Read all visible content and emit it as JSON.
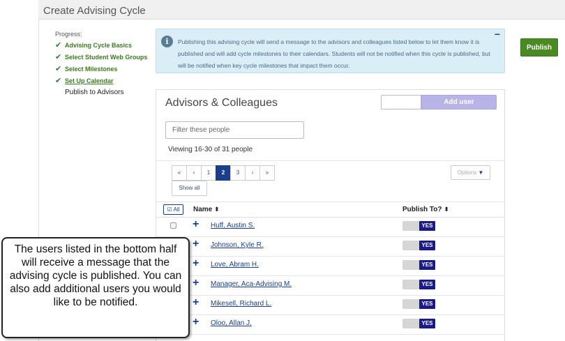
{
  "page": {
    "title": "Create Advising Cycle"
  },
  "progress": {
    "label": "Progress:",
    "steps": [
      {
        "label": "Advising Cycle Basics",
        "status": "complete"
      },
      {
        "label": "Select Student Web Groups",
        "status": "complete"
      },
      {
        "label": "Select Milestones",
        "status": "complete"
      },
      {
        "label": "Set Up Calendar",
        "status": "complete-link"
      },
      {
        "label": "Publish to Advisors",
        "status": "current"
      }
    ]
  },
  "info": {
    "text": "Publishing this advising cycle will send a message to the advisors and colleagues listed below to let them know it is published and will add cycle milestones to their calendars. Students will not be notified when this cycle is published, but will be notified when key cycle milestones that impact them occur.",
    "collapse_symbol": "−"
  },
  "actions": {
    "publish_label": "Publish"
  },
  "panel": {
    "title": "Advisors & Colleagues",
    "add_user_label": "Add user",
    "filter_placeholder": "Filter these people",
    "viewing_text": "Viewing 16-30 of 31 people",
    "pager": [
      "«",
      "‹",
      "1",
      "2",
      "3",
      "›",
      "»"
    ],
    "pager_active": "2",
    "show_all_label": "Show all",
    "options_label": "Options",
    "table": {
      "all_label": "All",
      "col_name": "Name",
      "col_publish": "Publish To?",
      "sort_symbol": "⬍",
      "rows": [
        {
          "name": "Huff, Austin S.",
          "publish": "YES"
        },
        {
          "name": "Johnson, Kyle R.",
          "publish": "YES"
        },
        {
          "name": "Love, Abram H.",
          "publish": "YES"
        },
        {
          "name": "Manager, Aca-Advising M.",
          "publish": "YES"
        },
        {
          "name": "Mikesell, Richard L.",
          "publish": "YES"
        },
        {
          "name": "Oloo, Allan J.",
          "publish": "YES"
        }
      ]
    }
  },
  "callout": {
    "text": "The users listed in the bottom half will receive a message that the advising cycle is published. You can also add additional users you would like to be notified."
  },
  "colors": {
    "accent_green": "#4a8a22",
    "link_blue": "#1a3e8c",
    "info_bg": "#daeef7",
    "add_user_bg": "#b8b4e8"
  },
  "icons": {
    "step_check": "checkmark-icon",
    "info": "info-icon",
    "row_expand": "plus-icon",
    "sort": "sort-icon",
    "select_all": "checkbox-icon"
  }
}
